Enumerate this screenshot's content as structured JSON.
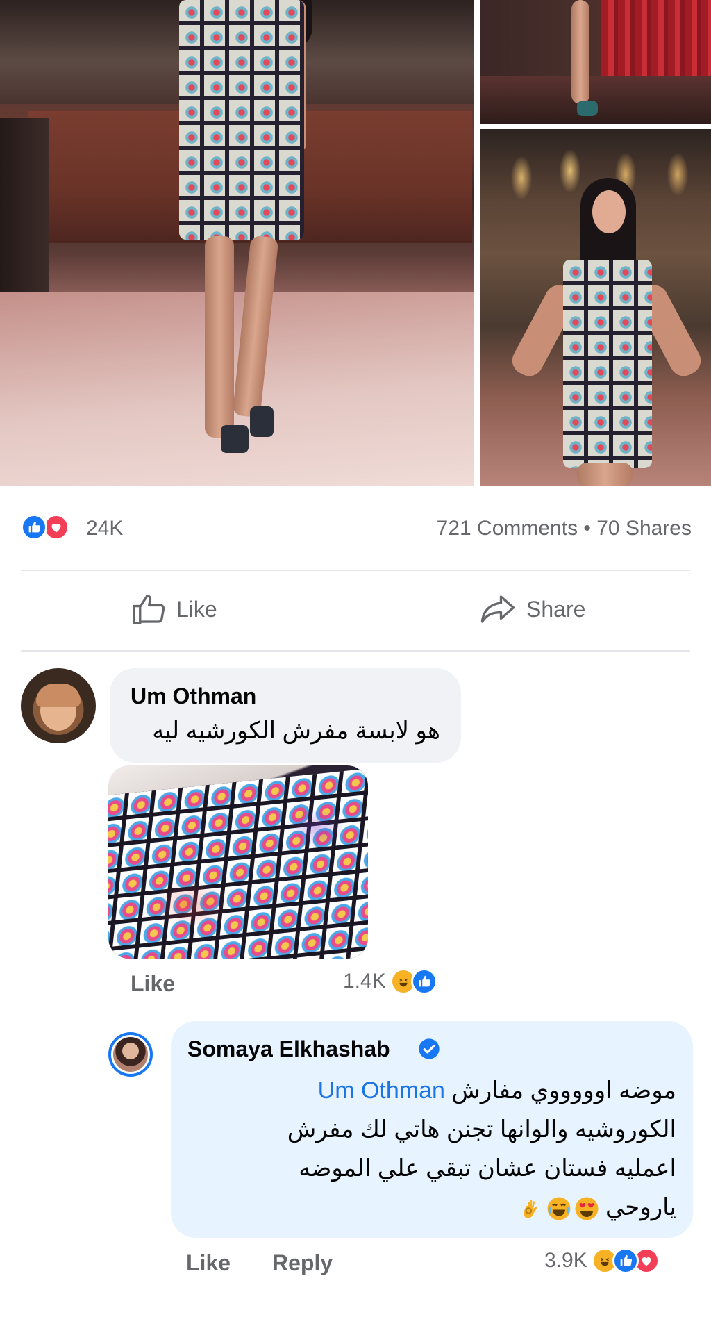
{
  "post": {
    "reaction_count": "24K",
    "comments_shares": "721 Comments • 70 Shares",
    "actions": {
      "like_label": "Like",
      "share_label": "Share"
    },
    "reaction_icons": [
      "like-icon",
      "love-icon"
    ]
  },
  "comments": [
    {
      "author": "Um Othman",
      "text": "هو لابسة مفرش الكورشيه ليه",
      "like_label": "Like",
      "reaction_count": "1.4K",
      "reaction_icons": [
        "haha-icon",
        "like-icon"
      ]
    },
    {
      "author": "Somaya Elkhashab",
      "verified": true,
      "mention": "Um Othman",
      "text_line1": "موضه اوووووي مفارش",
      "text_line2": "الكوروشيه والوانها تجنن هاتي لك مفرش",
      "text_line3": "اعمليه فستان عشان تبقي علي الموضه",
      "text_line4": "ياروحي",
      "emojis": [
        "heart-eyes-icon",
        "joy-icon",
        "ok-hand-icon"
      ],
      "like_label": "Like",
      "reply_label": "Reply",
      "reaction_count": "3.9K",
      "reaction_icons": [
        "haha-icon",
        "like-icon",
        "love-icon"
      ]
    }
  ],
  "colors": {
    "facebook_blue": "#1877f2",
    "love_red": "#f33e58",
    "haha_yellow": "#f7b125",
    "meta_gray": "#65676b",
    "bubble_gray": "#f0f2f5",
    "bubble_highlight": "#e7f3ff"
  }
}
